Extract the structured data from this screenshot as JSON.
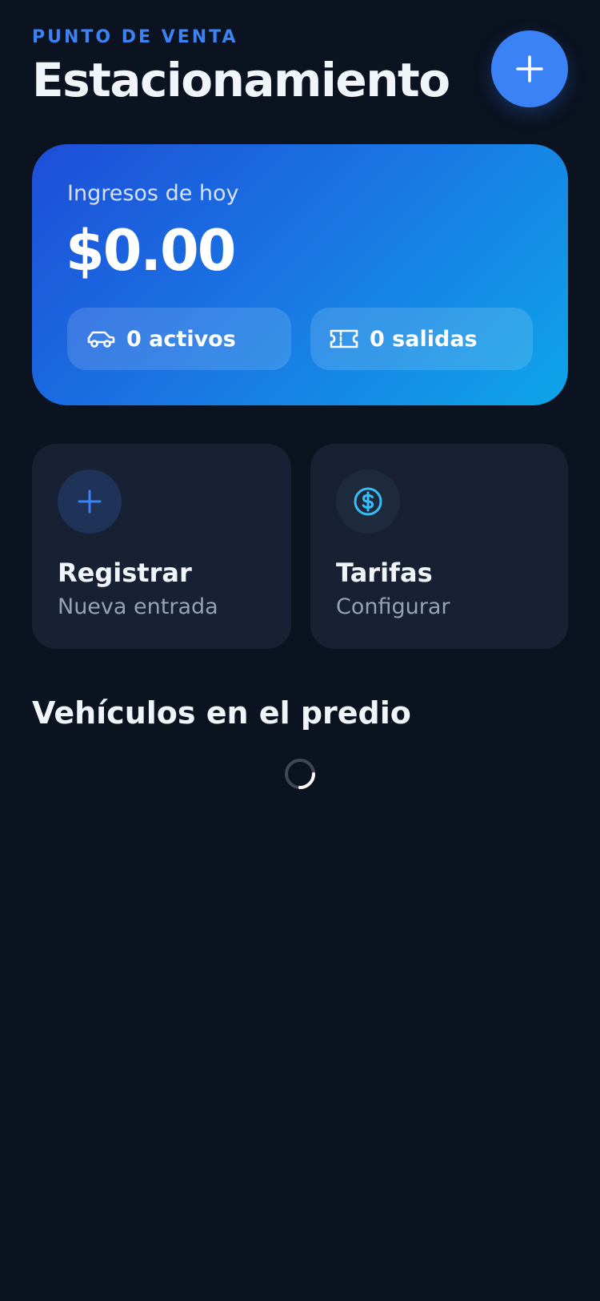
{
  "header": {
    "eyebrow": "PUNTO DE VENTA",
    "title": "Estacionamiento",
    "add_button_icon": "plus-icon"
  },
  "revenue": {
    "label": "Ingresos de hoy",
    "amount": "$0.00",
    "active": {
      "icon": "car-icon",
      "text": "0 activos"
    },
    "exits": {
      "icon": "ticket-icon",
      "text": "0 salidas"
    }
  },
  "actions": {
    "register": {
      "icon": "plus-icon",
      "title": "Registrar",
      "subtitle": "Nueva entrada"
    },
    "rates": {
      "icon": "dollar-circle-icon",
      "title": "Tarifas",
      "subtitle": "Configurar"
    }
  },
  "vehicles": {
    "title": "Vehículos en el predio",
    "loading_icon": "spinner-icon"
  },
  "colors": {
    "background": "#0b1220",
    "accent": "#3b82f6",
    "card": "#172133",
    "gradient_start": "#1d4ed8",
    "gradient_end": "#0ea5e9",
    "text_primary": "#f1f5f9",
    "text_muted": "#94a3b8"
  }
}
